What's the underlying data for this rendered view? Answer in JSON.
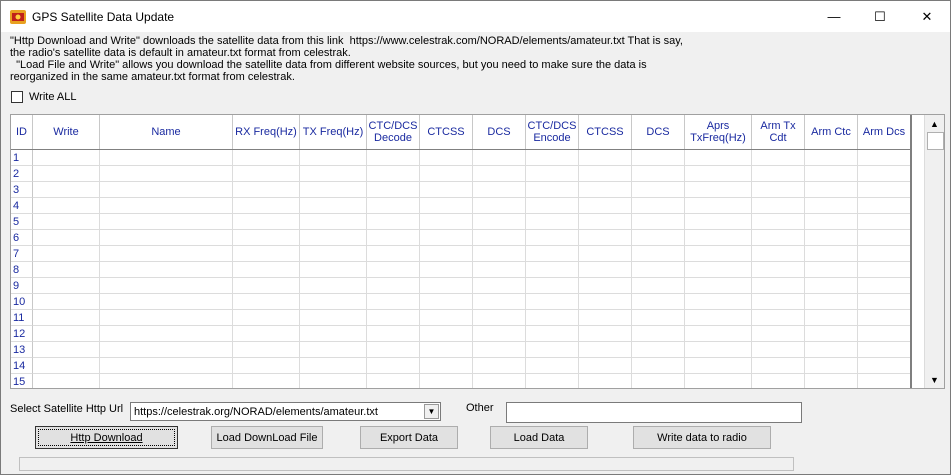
{
  "window": {
    "title": "GPS Satellite Data Update",
    "minimize_glyph": "—",
    "maximize_glyph": "☐",
    "close_glyph": "✕"
  },
  "info": {
    "line1": "\"Http Download and Write\" downloads the satellite data from this link  https://www.celestrak.com/NORAD/elements/amateur.txt That is say,",
    "line2": "the radio's satellite data is default in amateur.txt format from celestrak.",
    "line3": "  \"Load File and Write\" allows you download the satellite data from different website sources, but you need to make sure the data is",
    "line4": "reorganized in the same amateur.txt format from celestrak."
  },
  "write_all": {
    "label": "Write ALL",
    "checked": false
  },
  "table": {
    "columns": [
      {
        "label": "ID",
        "key": "id"
      },
      {
        "label": "Write",
        "key": "write"
      },
      {
        "label": "Name",
        "key": "name"
      },
      {
        "label": "RX Freq(Hz)",
        "key": "rx"
      },
      {
        "label": "TX Freq(Hz)",
        "key": "tx"
      },
      {
        "label": "CTC/DCS Decode",
        "key": "ctcdec"
      },
      {
        "label": "CTCSS",
        "key": "ctcss1"
      },
      {
        "label": "DCS",
        "key": "dcs1"
      },
      {
        "label": "CTC/DCS Encode",
        "key": "ctcenc"
      },
      {
        "label": "CTCSS",
        "key": "ctcss2"
      },
      {
        "label": "DCS",
        "key": "dcs2"
      },
      {
        "label": "Aprs TxFreq(Hz)",
        "key": "aprs"
      },
      {
        "label": "Arm Tx Cdt",
        "key": "armtx"
      },
      {
        "label": "Arm Ctc",
        "key": "armctc"
      },
      {
        "label": "Arm Dcs",
        "key": "armdcs"
      }
    ],
    "row_ids": [
      "1",
      "2",
      "3",
      "4",
      "5",
      "6",
      "7",
      "8",
      "9",
      "10",
      "11",
      "12",
      "13",
      "14",
      "15"
    ]
  },
  "url_select": {
    "label": "Select Satellite Http Url",
    "value": "https://celestrak.org/NORAD/elements/amateur.txt"
  },
  "other": {
    "label": "Other",
    "value": ""
  },
  "buttons": {
    "http_download": "Http Download",
    "load_download_file": "Load DownLoad File",
    "export_data": "Export Data",
    "load_data": "Load  Data",
    "write_data": "Write data to radio"
  },
  "colors": {
    "header_text": "#1a2aa0",
    "grid_filler": "#7f7f7f"
  }
}
